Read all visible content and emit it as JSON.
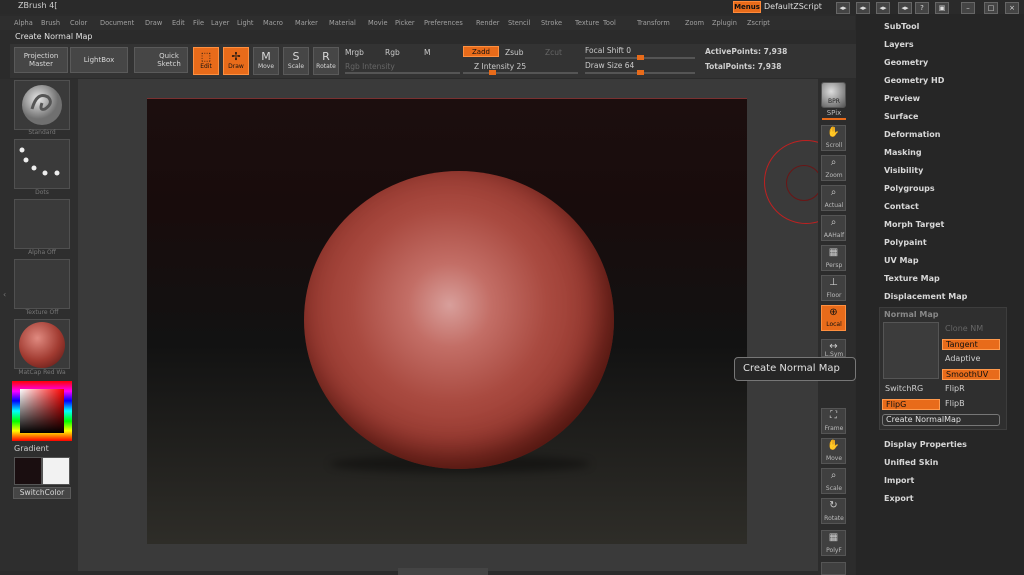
{
  "app": {
    "title": "ZBrush 4[",
    "menus_label": "Menus",
    "zscript_label": "DefaultZScript"
  },
  "menubar": [
    "Alpha",
    "Brush",
    "Color",
    "Document",
    "Draw",
    "Edit",
    "File",
    "Layer",
    "Light",
    "Macro",
    "Marker",
    "Material",
    "Movie",
    "Picker",
    "Preferences",
    "Render",
    "Stencil",
    "Stroke",
    "Texture",
    "Tool",
    "Transform",
    "Zoom",
    "Zplugin",
    "Zscript"
  ],
  "command": {
    "name": "Create Normal Map"
  },
  "toolbar": {
    "projection_master": "Projection Master",
    "lightbox": "LightBox",
    "quick_sketch": "Quick Sketch",
    "edit": "Edit",
    "draw": "Draw",
    "move": "Move",
    "scale": "Scale",
    "rotate": "Rotate",
    "mrgb": "Mrgb",
    "rgb": "Rgb",
    "m": "M",
    "rgb_intensity": "Rgb Intensity",
    "zadd": "Zadd",
    "zsub": "Zsub",
    "zcut": "Zcut",
    "z_intensity": "Z Intensity 25",
    "focal_shift": "Focal Shift 0",
    "draw_size": "Draw Size 64",
    "active_points": "ActivePoints: 7,938",
    "total_points": "TotalPoints: 7,938",
    "z_intensity_value": 25,
    "focal_shift_value": 0,
    "draw_size_value": 64
  },
  "leftshelf": {
    "brush": "Standard",
    "stroke": "Dots",
    "alpha": "Alpha  Off",
    "texture": "Texture  Off",
    "material": "MatCap  Red  Wa",
    "gradient": "Gradient",
    "switch_color": "SwitchColor"
  },
  "rightshelf": {
    "bpr": "BPR",
    "spix": "SPix",
    "scroll": "Scroll",
    "zoom": "Zoom",
    "actual": "Actual",
    "aahalf": "AAHalf",
    "persp": "Persp",
    "floor": "Floor",
    "local": "Local",
    "lsym": "L.Sym",
    "frame": "Frame",
    "move": "Move",
    "scale": "Scale",
    "rotate": "Rotate",
    "polyf": "PolyF"
  },
  "tooltip": "Create Normal Map",
  "subtool_palette": {
    "items": [
      "SubTool",
      "Layers",
      "Geometry",
      "Geometry HD",
      "Preview",
      "Surface",
      "Deformation",
      "Masking",
      "Visibility",
      "Polygroups",
      "Contact",
      "Morph Target",
      "Polypaint",
      "UV Map",
      "Texture Map",
      "Displacement Map"
    ],
    "items_after": [
      "Display Properties",
      "Unified Skin",
      "Import",
      "Export"
    ],
    "normal_map": {
      "title": "Normal Map",
      "clone_nm": "Clone NM",
      "tangent": "Tangent",
      "adaptive": "Adaptive",
      "smoothuv": "SmoothUV",
      "switchrg": "SwitchRG",
      "flipr": "FlipR",
      "flipg": "FlipG",
      "flipb": "FlipB",
      "create": "Create NormalMap"
    }
  },
  "colors": {
    "accent": "#e86b1a",
    "background": "#2b2b2b",
    "sphere": "#a94a40"
  },
  "icons": [
    "window-minimize-icon",
    "window-maximize-icon",
    "window-close-icon",
    "brush-sphere-icon",
    "dots-icon",
    "hand-icon",
    "magnifier-icon",
    "grid-icon",
    "gyro-icon"
  ]
}
